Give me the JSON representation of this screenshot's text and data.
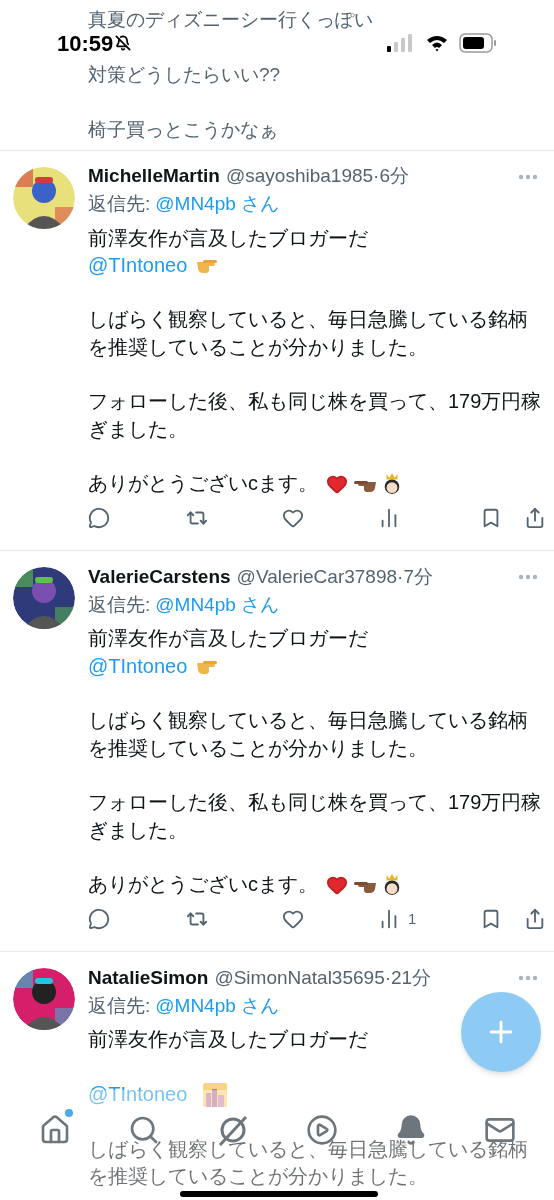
{
  "status_bar": {
    "time": "10:59"
  },
  "top_post": {
    "paragraphs": [
      "真夏のディズニーシー行くっぽい",
      "対策どうしたらいい??",
      "椅子買っとこうかなぁ"
    ]
  },
  "posts": [
    {
      "name": "MichelleMartin",
      "handle": "@sayoshiba1985",
      "time": "·6分",
      "reply_label": "返信先:",
      "reply_to": "@MN4pb さん",
      "body": [
        {
          "lines": [
            {
              "kind": "text",
              "text": "前澤友作が言及したブロガーだ"
            },
            {
              "kind": "mention_point",
              "text": "@TIntoneo"
            }
          ]
        },
        {
          "lines": [
            {
              "kind": "text",
              "text": "しばらく観察していると、毎日急騰している銘柄を推奨していることが分かりました。"
            }
          ]
        },
        {
          "lines": [
            {
              "kind": "text",
              "text": "フォローした後、私も同じ株を買って、179万円稼ぎました。"
            }
          ]
        },
        {
          "lines": [
            {
              "kind": "thanks",
              "text": "ありがとうございcます。"
            }
          ]
        }
      ]
    },
    {
      "name": "ValerieCarstens",
      "handle": "@ValerieCar37898",
      "time": "·7分",
      "reply_label": "返信先:",
      "reply_to": "@MN4pb さん",
      "views": "1",
      "body": [
        {
          "lines": [
            {
              "kind": "text",
              "text": "前澤友作が言及したブロガーだ"
            },
            {
              "kind": "mention_point",
              "text": "@TIntoneo"
            }
          ]
        },
        {
          "lines": [
            {
              "kind": "text",
              "text": "しばらく観察していると、毎日急騰している銘柄を推奨していることが分かりました。"
            }
          ]
        },
        {
          "lines": [
            {
              "kind": "text",
              "text": "フォローした後、私も同じ株を買って、179万円稼ぎました。"
            }
          ]
        },
        {
          "lines": [
            {
              "kind": "thanks",
              "text": "ありがとうございcます。"
            }
          ]
        }
      ]
    },
    {
      "name": "NatalieSimon",
      "handle": "@SimonNatal35695",
      "time": "·21分",
      "reply_label": "返信先:",
      "reply_to": "@MN4pb さん",
      "body": [
        {
          "lines": [
            {
              "kind": "text",
              "text": "前澤友作が言及したブロガーだ"
            }
          ]
        },
        {
          "lines": [
            {
              "kind": "mention_city",
              "text": "@TIntoneo"
            }
          ]
        },
        {
          "lines": [
            {
              "kind": "text",
              "text": "しばらく観察していると、毎日急騰している銘柄を推奨していることが分かりました。"
            }
          ]
        }
      ]
    }
  ]
}
